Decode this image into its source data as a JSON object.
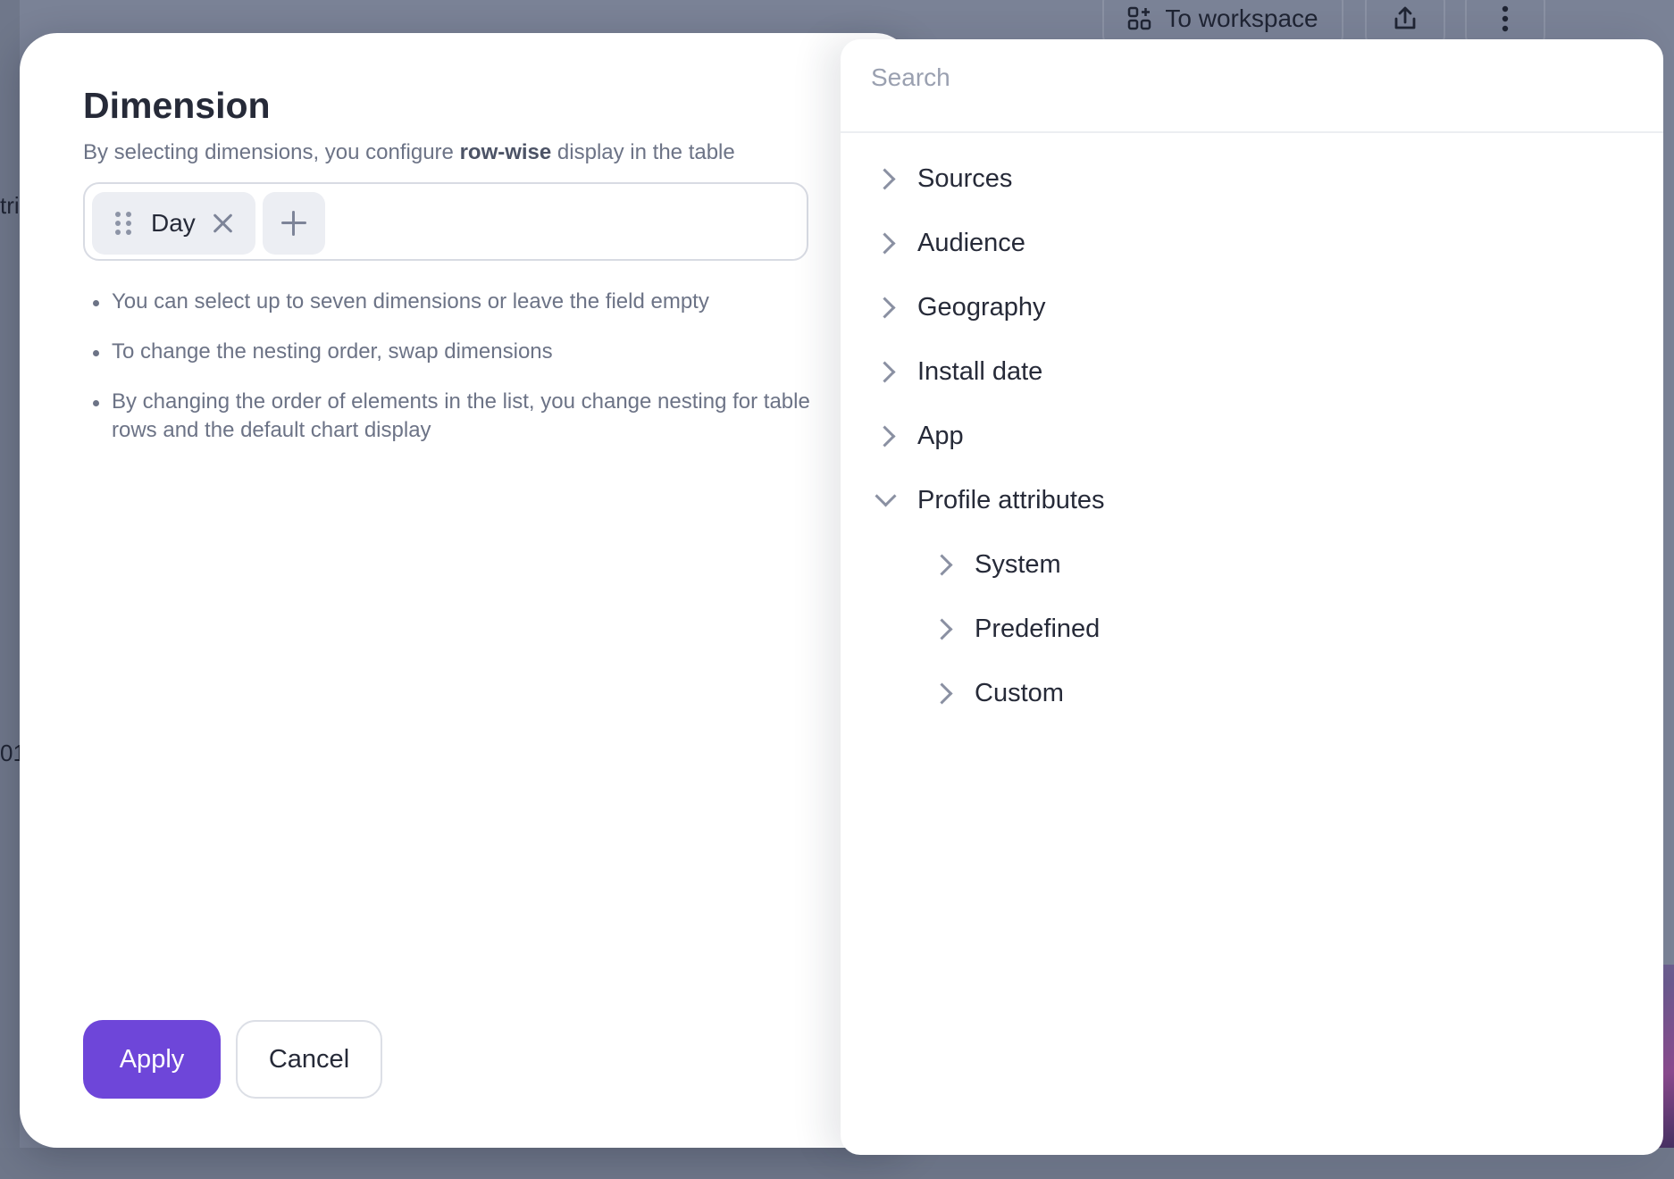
{
  "background": {
    "workspace_button": "To workspace",
    "left_stub_top": "tri",
    "left_stub_bottom": "01"
  },
  "modal": {
    "title": "Dimension",
    "subtitle_pre": "By selecting dimensions, you configure ",
    "subtitle_bold": "row-wise",
    "subtitle_post": " display in the table",
    "selected": [
      {
        "label": "Day"
      }
    ],
    "hints": [
      "You can select up to seven dimensions or leave the field empty",
      "To change the nesting order, swap dimensions",
      "By changing the order of elements in the list, you change nesting for table rows and the default chart display"
    ],
    "apply_label": "Apply",
    "cancel_label": "Cancel"
  },
  "picker": {
    "search_placeholder": "Search",
    "items": [
      {
        "label": "Sources",
        "expanded": false
      },
      {
        "label": "Audience",
        "expanded": false
      },
      {
        "label": "Geography",
        "expanded": false
      },
      {
        "label": "Install date",
        "expanded": false
      },
      {
        "label": "App",
        "expanded": false
      },
      {
        "label": "Profile attributes",
        "expanded": true,
        "children": [
          {
            "label": "System"
          },
          {
            "label": "Predefined"
          },
          {
            "label": "Custom"
          }
        ]
      }
    ]
  },
  "colors": {
    "accent": "#6e46d9",
    "overlay": "#7a8296"
  }
}
